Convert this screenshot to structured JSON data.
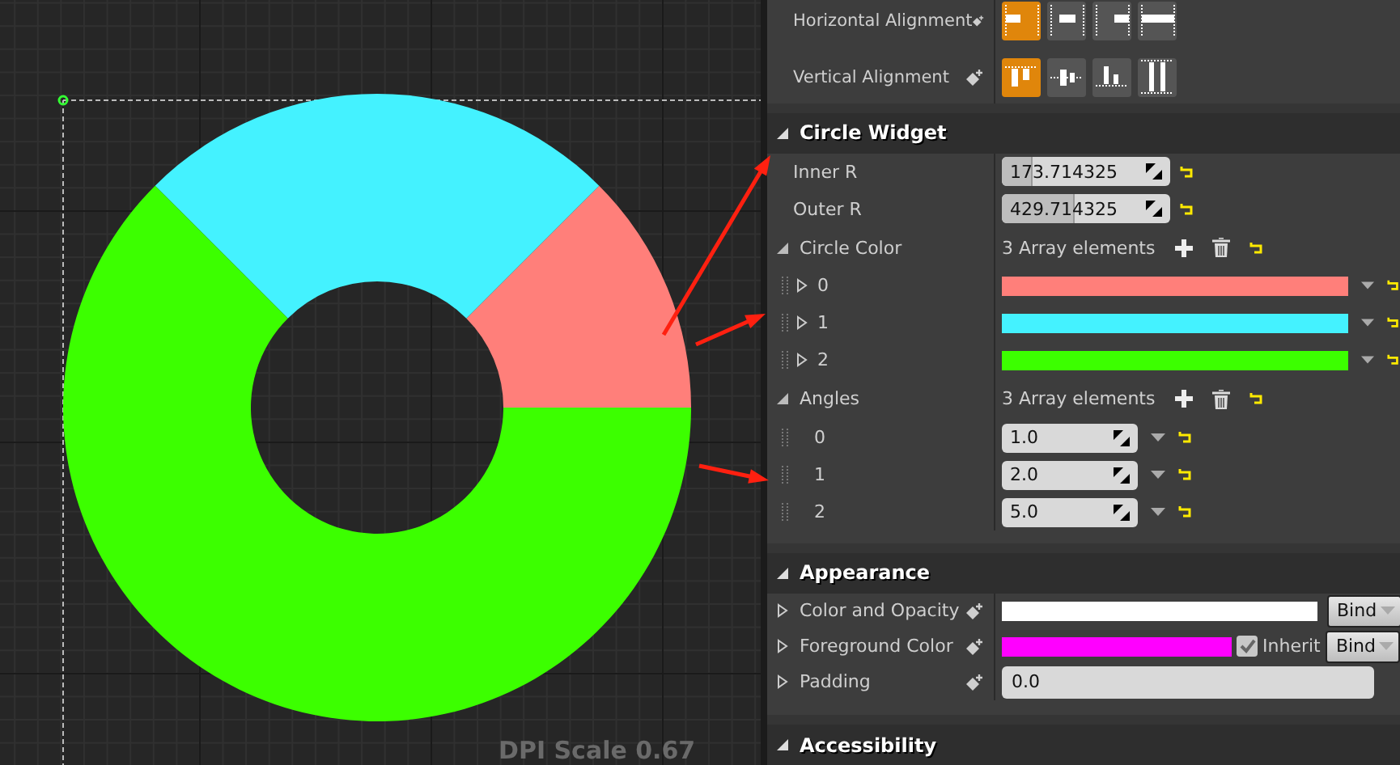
{
  "viewport": {
    "caption": "DPI Scale 0.67"
  },
  "alignment": [
    {
      "label": "Horizontal Alignment",
      "kind": "horizontal",
      "options": [
        {
          "selected": true
        },
        {
          "selected": false
        },
        {
          "selected": false
        },
        {
          "selected": false
        }
      ]
    },
    {
      "label": "Vertical Alignment",
      "kind": "vertical",
      "options": [
        {
          "selected": true
        },
        {
          "selected": false
        },
        {
          "selected": false
        },
        {
          "selected": false
        }
      ]
    }
  ],
  "circle_widget": {
    "title": "Circle Widget",
    "expanded": true,
    "inner_r": {
      "label": "Inner R",
      "value": "173.714325",
      "level": 0.17
    },
    "outer_r": {
      "label": "Outer R",
      "value": "429.714325",
      "level": 0.42
    },
    "circle_color": {
      "label": "Circle Color",
      "count": "3 Array elements",
      "items": [
        {
          "index": "0",
          "color": "#ff7f7a"
        },
        {
          "index": "1",
          "color": "#44f2ff"
        },
        {
          "index": "2",
          "color": "#3cff00"
        }
      ]
    },
    "angles": {
      "label": "Angles",
      "count": "3 Array elements",
      "items": [
        {
          "index": "0",
          "value": "1.0"
        },
        {
          "index": "1",
          "value": "2.0"
        },
        {
          "index": "2",
          "value": "5.0"
        }
      ]
    }
  },
  "appearance": {
    "title": "Appearance",
    "expanded": true,
    "color_and_opacity": {
      "label": "Color and Opacity",
      "color": "#ffffff",
      "bind": "Bind"
    },
    "foreground_color": {
      "label": "Foreground Color",
      "color": "#ff00ff",
      "inherit_label": "Inherit",
      "inherit_checked": true,
      "bind": "Bind"
    },
    "padding": {
      "label": "Padding",
      "value": "0.0"
    }
  },
  "accessibility": {
    "title": "Accessibility",
    "expanded": true
  }
}
